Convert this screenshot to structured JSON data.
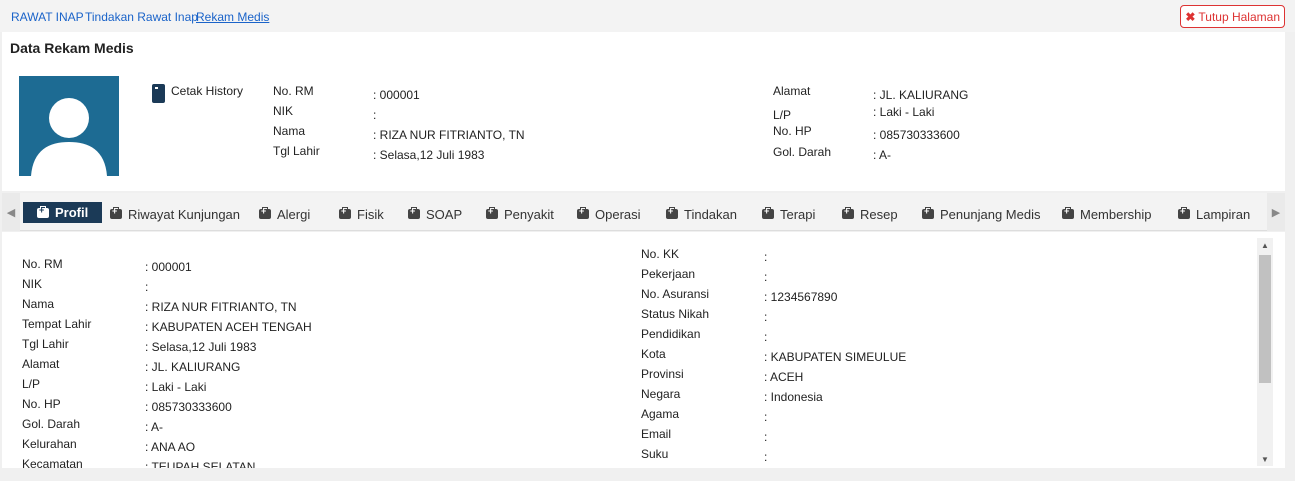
{
  "breadcrumb": [
    "RAWAT INAP",
    "Tindakan Rawat Inap",
    "Rekam Medis"
  ],
  "close_button": "Tutup Halaman",
  "panel_title": "Data Rekam Medis",
  "cetak_label": "Cetak History",
  "header_left": [
    {
      "label": "No. RM",
      "value": ": 000001"
    },
    {
      "label": "NIK",
      "value": ":"
    },
    {
      "label": "Nama",
      "value": ": RIZA NUR FITRIANTO, TN"
    },
    {
      "label": "Tgl Lahir",
      "value": ": Selasa,12 Juli 1983"
    }
  ],
  "header_right": [
    {
      "label": "Alamat",
      "value": ": JL. KALIURANG"
    },
    {
      "label": "L/P",
      "value": ": Laki - Laki"
    },
    {
      "label": "No. HP",
      "value": ": 085730333600"
    },
    {
      "label": "Gol. Darah",
      "value": ": A-"
    }
  ],
  "tabs": [
    "Profil",
    "Riwayat Kunjungan",
    "Alergi",
    "Fisik",
    "SOAP",
    "Penyakit",
    "Operasi",
    "Tindakan",
    "Terapi",
    "Resep",
    "Penunjang Medis",
    "Membership",
    "Lampiran"
  ],
  "active_tab": "Profil",
  "profile_left": [
    {
      "label": "No. RM",
      "value": ": 000001"
    },
    {
      "label": "NIK",
      "value": ":"
    },
    {
      "label": "Nama",
      "value": ": RIZA NUR FITRIANTO, TN"
    },
    {
      "label": "Tempat Lahir",
      "value": ": KABUPATEN ACEH TENGAH"
    },
    {
      "label": "Tgl Lahir",
      "value": ": Selasa,12 Juli 1983"
    },
    {
      "label": "Alamat",
      "value": ": JL. KALIURANG"
    },
    {
      "label": "L/P",
      "value": ": Laki - Laki"
    },
    {
      "label": "No. HP",
      "value": ": 085730333600"
    },
    {
      "label": "Gol. Darah",
      "value": ": A-"
    },
    {
      "label": "Kelurahan",
      "value": ": ANA AO"
    },
    {
      "label": "Kecamatan",
      "value": ": TEUPAH SELATAN"
    }
  ],
  "profile_right": [
    {
      "label": "No. KK",
      "value": ":"
    },
    {
      "label": "Pekerjaan",
      "value": ":"
    },
    {
      "label": "No. Asuransi",
      "value": ": 1234567890"
    },
    {
      "label": "Status Nikah",
      "value": ":"
    },
    {
      "label": "Pendidikan",
      "value": ":"
    },
    {
      "label": "Kota",
      "value": ": KABUPATEN SIMEULUE"
    },
    {
      "label": "Provinsi",
      "value": ": ACEH"
    },
    {
      "label": "Negara",
      "value": ": Indonesia"
    },
    {
      "label": "Agama",
      "value": ":"
    },
    {
      "label": "Email",
      "value": ":"
    },
    {
      "label": "Suku",
      "value": ":"
    }
  ],
  "colors": {
    "accent": "#1a63c9",
    "active_tab": "#1b3a57",
    "avatar_bg": "#1d6b93",
    "danger": "#dd3333"
  },
  "icons": {
    "close": "close-icon",
    "cetak": "book-icon",
    "tab": "medkit-icon",
    "avatar": "user-silhouette-icon"
  }
}
